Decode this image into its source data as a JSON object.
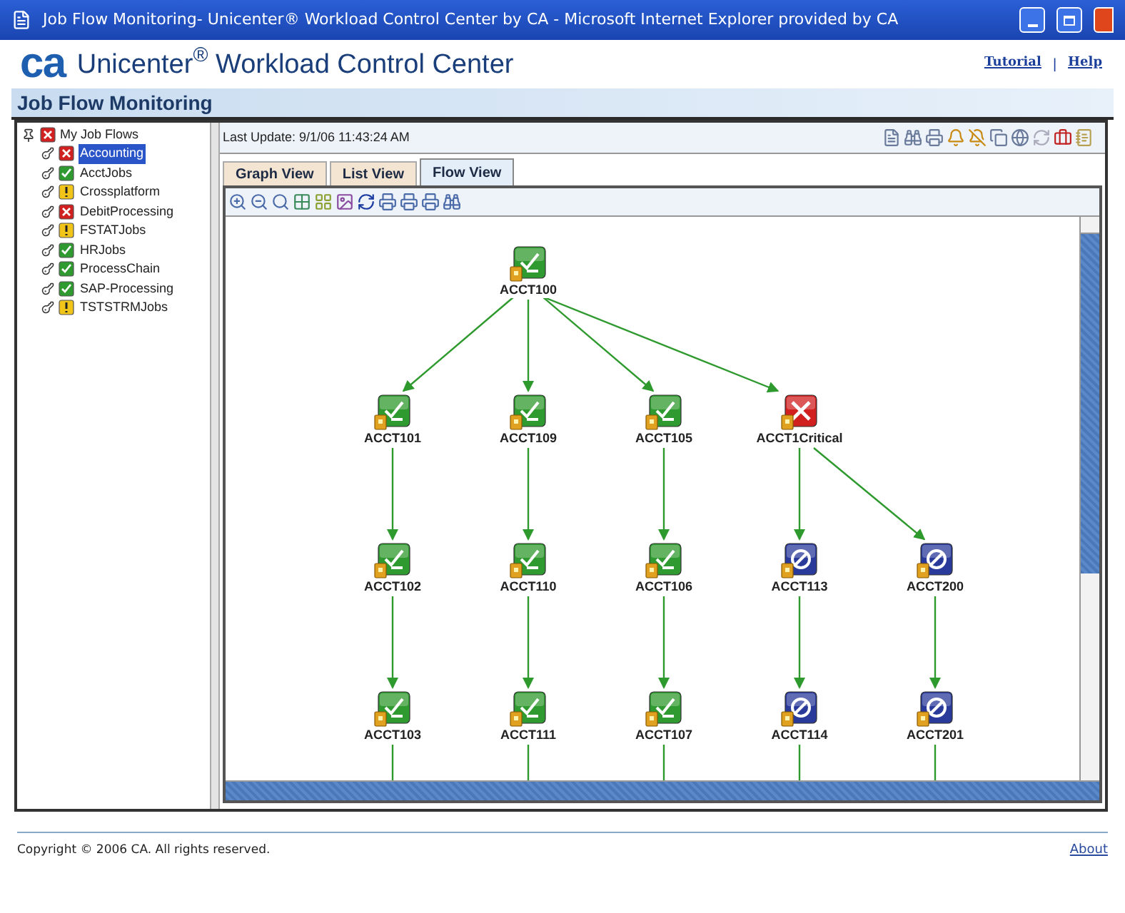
{
  "window": {
    "title": "Job Flow Monitoring- Unicenter® Workload Control Center by CA - Microsoft Internet Explorer provided by CA"
  },
  "header": {
    "logo": "ca",
    "product": "Unicenter$^{®}$ Workload Control Center",
    "links": [
      "Tutorial",
      "Help"
    ],
    "separator": "|"
  },
  "page_title": "Job Flow Monitoring",
  "tree": {
    "label": "My Job Flows",
    "kind": "failed",
    "children": [
      {
        "label": "Accounting",
        "kind": "failed",
        "selected": true
      },
      {
        "label": "AcctJobs",
        "kind": "ok",
        "selected": false
      },
      {
        "label": "Crossplatform",
        "kind": "warning",
        "selected": false
      },
      {
        "label": "DebitProcessing",
        "kind": "failed",
        "selected": false
      },
      {
        "label": "FSTATJobs",
        "kind": "warning",
        "selected": false
      },
      {
        "label": "HRJobs",
        "kind": "ok",
        "selected": false
      },
      {
        "label": "ProcessChain",
        "kind": "ok",
        "selected": false
      },
      {
        "label": "SAP-Processing",
        "kind": "ok",
        "selected": false
      },
      {
        "label": "TSTSTRMJobs",
        "kind": "warning",
        "selected": false
      }
    ]
  },
  "last_update": "Last Update: 9/1/06 11:43:24 AM",
  "tabs": [
    {
      "label": "Graph View",
      "selected": false
    },
    {
      "label": "List View",
      "selected": false
    },
    {
      "label": "Flow View",
      "selected": true
    }
  ],
  "flow": {
    "root": {
      "label": "ACCT100",
      "kind": "ok",
      "children": [
        {
          "label": "ACCT101",
          "kind": "ok",
          "children": [
            {
              "label": "ACCT102",
              "kind": "ok",
              "children": [
                {
                  "label": "ACCT103",
                  "kind": "ok"
                }
              ]
            }
          ]
        },
        {
          "label": "ACCT109",
          "kind": "ok",
          "children": [
            {
              "label": "ACCT110",
              "kind": "ok",
              "children": [
                {
                  "label": "ACCT111",
                  "kind": "ok"
                }
              ]
            }
          ]
        },
        {
          "label": "ACCT105",
          "kind": "ok",
          "children": [
            {
              "label": "ACCT106",
              "kind": "ok",
              "children": [
                {
                  "label": "ACCT107",
                  "kind": "ok"
                }
              ]
            }
          ]
        },
        {
          "label": "ACCT1Critical",
          "kind": "failed",
          "children": [
            {
              "label": "ACCT113",
              "kind": "blocked",
              "children": [
                {
                  "label": "ACCT114",
                  "kind": "blocked"
                }
              ]
            },
            {
              "label": "ACCT200",
              "kind": "blocked",
              "children": [
                {
                  "label": "ACCT201",
                  "kind": "blocked"
                }
              ]
            }
          ]
        }
      ]
    }
  },
  "footer": {
    "copyright": "Copyright © 2006 CA. All rights reserved.",
    "link": "About"
  }
}
